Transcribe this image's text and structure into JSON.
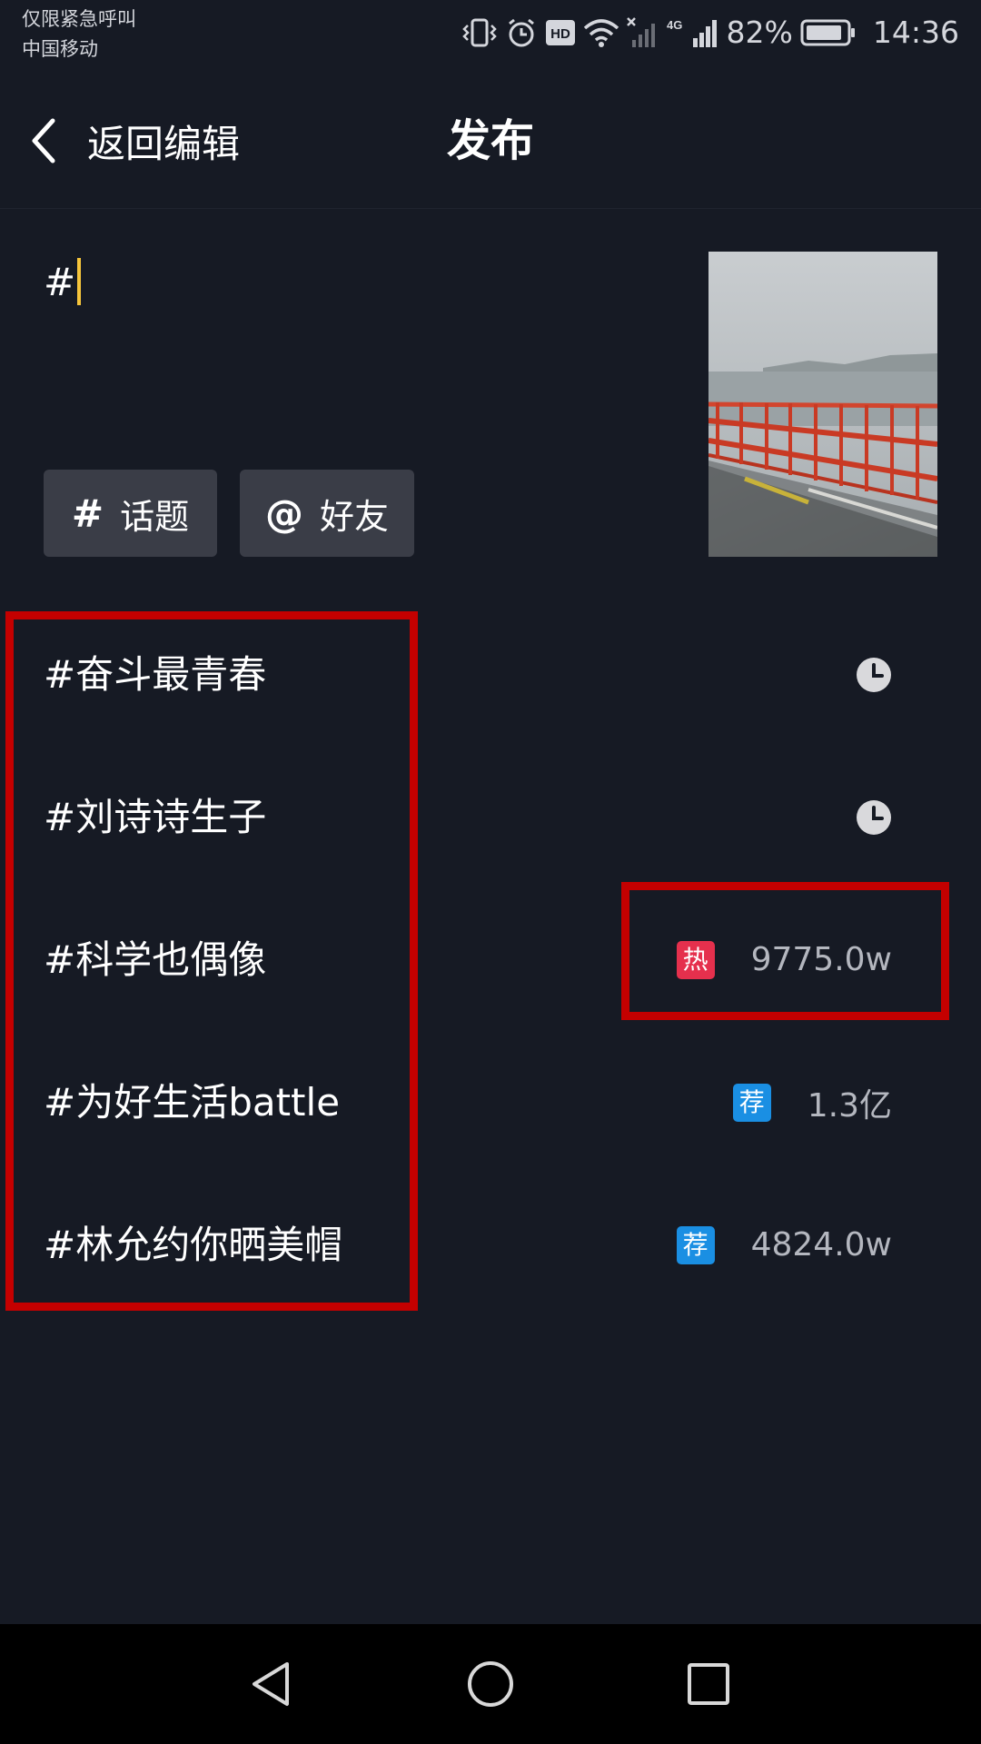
{
  "status_bar": {
    "carrier_line1": "仅限紧急呼叫",
    "carrier_line2": "中国移动",
    "network_label": "4G",
    "battery_percent": "82%",
    "time": "14:36",
    "icons": [
      "vibrate-icon",
      "alarm-icon",
      "hd-icon",
      "wifi-icon",
      "no-sim-signal-icon",
      "signal-icon",
      "battery-icon"
    ]
  },
  "header": {
    "back_label": "返回编辑",
    "title": "发布"
  },
  "caption": {
    "value": "#"
  },
  "chips": {
    "topic_symbol": "#",
    "topic_label": "话题",
    "friend_symbol": "@",
    "friend_label": "好友"
  },
  "suggestions": [
    {
      "label": "#奋斗最青春",
      "kind": "recent",
      "icon": "clock-icon"
    },
    {
      "label": "#刘诗诗生子",
      "kind": "recent",
      "icon": "clock-icon"
    },
    {
      "label": "#科学也偶像",
      "kind": "hot",
      "badge": "热",
      "metric": "9775.0w"
    },
    {
      "label": "#为好生活battle",
      "kind": "recommended",
      "badge": "荐",
      "metric": "1.3亿"
    },
    {
      "label": "#林允约你晒美帽",
      "kind": "recommended",
      "badge": "荐",
      "metric": "4824.0w"
    }
  ],
  "colors": {
    "background": "#161a24",
    "caret": "#f6c53b",
    "hot_badge": "#e5304d",
    "recommend_badge": "#1a8fe3",
    "highlight": "#c40000"
  }
}
